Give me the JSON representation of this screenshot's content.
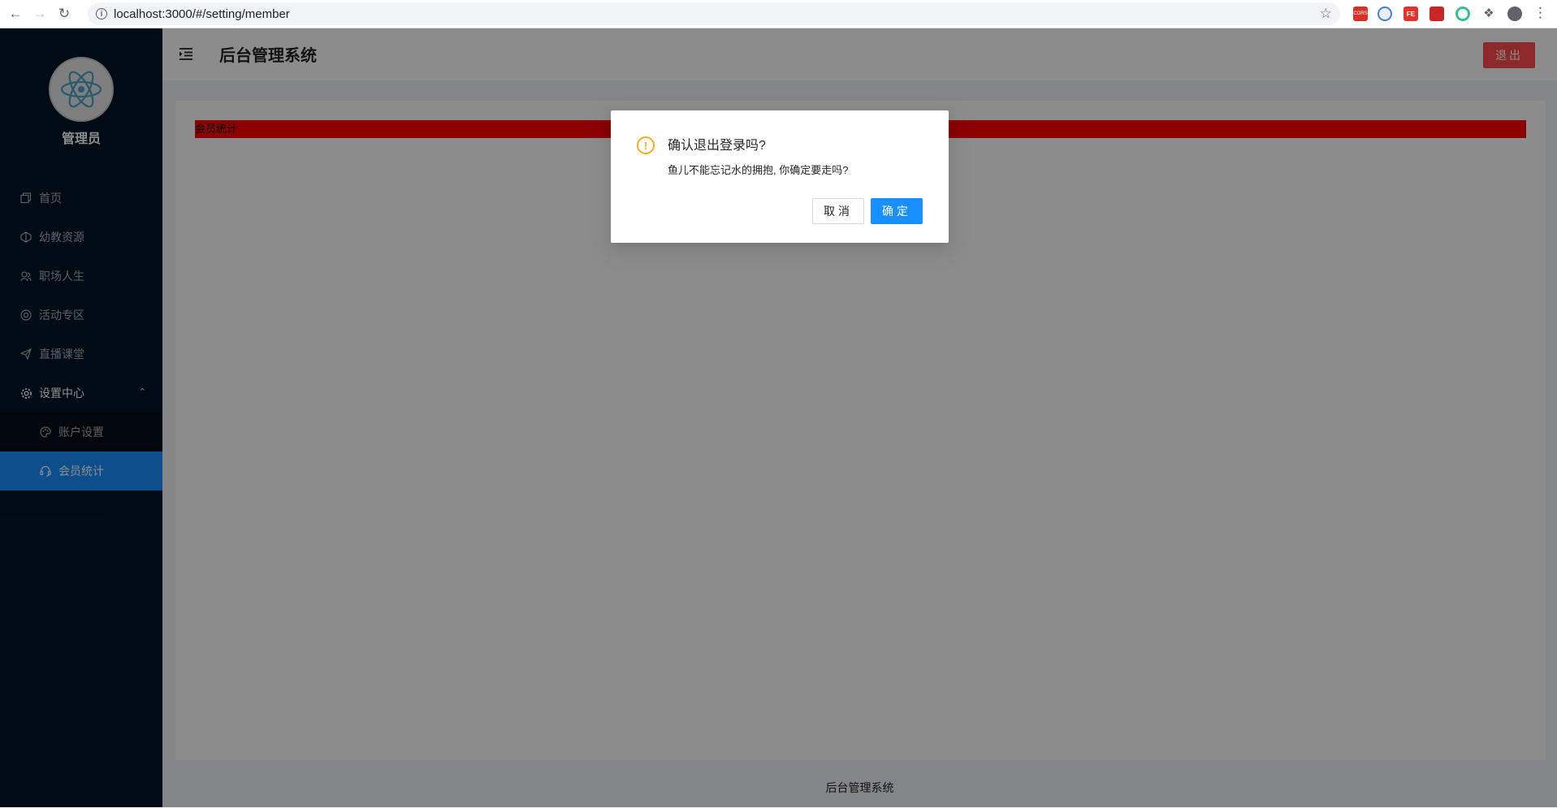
{
  "browser": {
    "url": "localhost:3000/#/setting/member",
    "extensions": [
      {
        "name": "cors-extension-icon",
        "color": "#d93025",
        "text": "CORS"
      },
      {
        "name": "blue-extension-icon",
        "color": "#4a7fd4",
        "text": ""
      },
      {
        "name": "fe-extension-icon",
        "color": "#e0342c",
        "text": "FE"
      },
      {
        "name": "red-extension-icon",
        "color": "#c62828",
        "text": ""
      },
      {
        "name": "green-extension-icon",
        "color": "#34c38f",
        "text": ""
      }
    ]
  },
  "sidebar": {
    "admin_name": "管理员",
    "items": [
      {
        "label": "首页",
        "icon": "copy-icon"
      },
      {
        "label": "幼教资源",
        "icon": "codepen-icon"
      },
      {
        "label": "职场人生",
        "icon": "user-group-icon"
      },
      {
        "label": "活动专区",
        "icon": "chrome-icon"
      },
      {
        "label": "直播课堂",
        "icon": "send-icon"
      },
      {
        "label": "设置中心",
        "icon": "gear-icon"
      }
    ],
    "sub_items": [
      {
        "label": "账户设置",
        "icon": "palette-icon"
      },
      {
        "label": "会员统计",
        "icon": "customer-service-icon"
      }
    ]
  },
  "header": {
    "title": "后台管理系统",
    "logout_label": "退出"
  },
  "content": {
    "bar_label": "会员统计"
  },
  "footer": {
    "text": "后台管理系统"
  },
  "modal": {
    "title": "确认退出登录吗?",
    "content": "鱼儿不能忘记水的拥抱, 你确定要走吗?",
    "cancel_label": "取消",
    "ok_label": "确定"
  },
  "colors": {
    "sidebar_bg": "#001529",
    "primary": "#1890ff",
    "danger": "#ff4d4f",
    "warning": "#faad14",
    "bar": "#ff0000"
  }
}
